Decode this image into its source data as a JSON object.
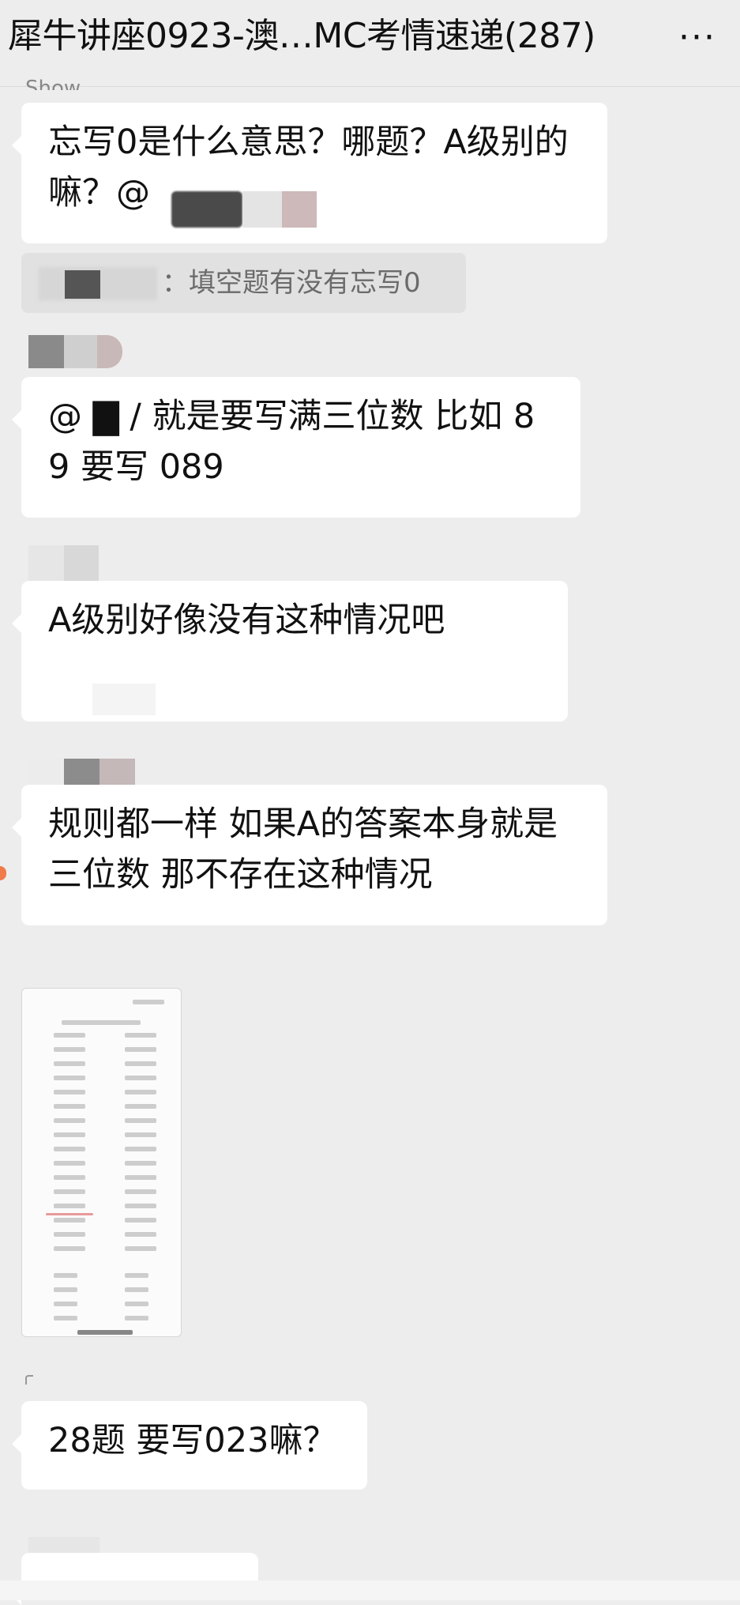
{
  "header": {
    "title": "犀牛讲座0923-澳…MC考情速递(287)",
    "more_label": "···"
  },
  "messages": [
    {
      "sender": "Show",
      "text": "忘写0是什么意思？哪题？A级别的嘛？@"
    },
    {
      "quote": "：填空题有没有忘写0"
    },
    {
      "text": "@ ▇ / 就是要写满三位数 比如 89 要写 089"
    },
    {
      "text": "A级别好像没有这种情况吧"
    },
    {
      "text": "规则都一样 如果A的答案本身就是三位数 那不存在这种情况"
    },
    {
      "image": "answer-sheet-image"
    },
    {
      "text": "28题 要写023嘛？"
    }
  ],
  "colors": {
    "background": "#ededed",
    "bubble": "#ffffff",
    "quote": "#e1e1e1"
  }
}
